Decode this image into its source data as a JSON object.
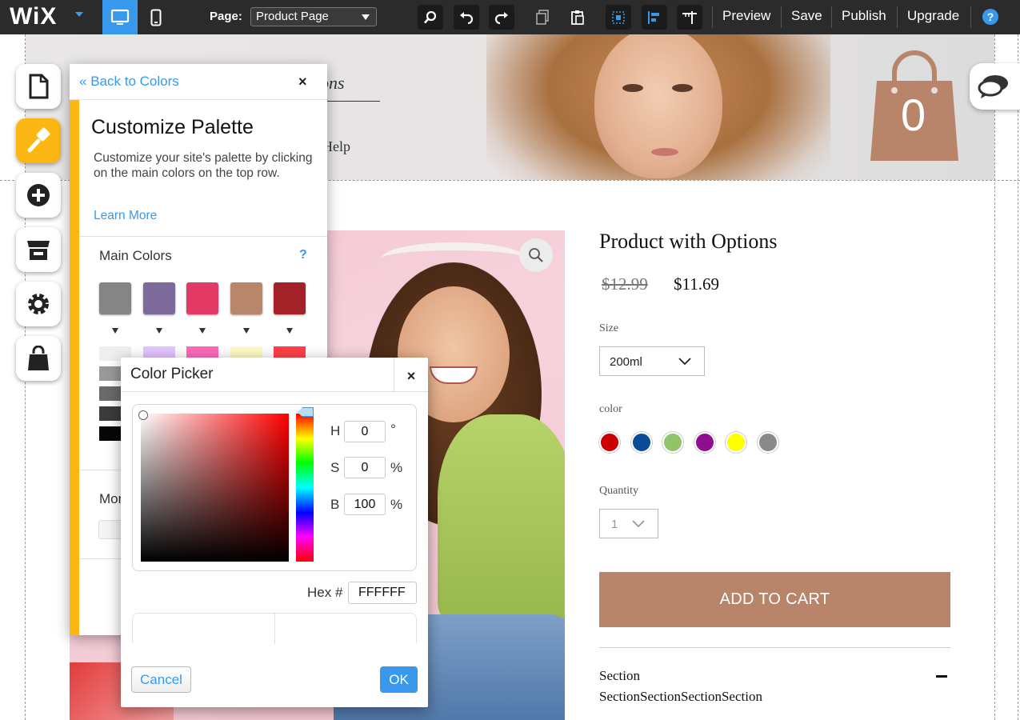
{
  "topbar": {
    "logo": "WiX",
    "page_label": "Page:",
    "page_value": "Product Page",
    "preview": "Preview",
    "save": "Save",
    "publish": "Publish",
    "upgrade": "Upgrade",
    "help": "?"
  },
  "header": {
    "nav_text": "ons",
    "help_text": "Help",
    "cart_count": "0"
  },
  "product": {
    "title": "Product with Options",
    "price_old": "$12.99",
    "price_new": "$11.69",
    "size_label": "Size",
    "size_value": "200ml",
    "color_label": "color",
    "colors": [
      "#cc0000",
      "#0b4c9a",
      "#8fc46b",
      "#8e0e8f",
      "#ffff00",
      "#8a8a8a"
    ],
    "quantity_label": "Quantity",
    "quantity_value": "1",
    "add_to_cart": "ADD TO CART",
    "section_title": "Section",
    "section_body": "SectionSectionSectionSection"
  },
  "palette_panel": {
    "back": "Back to Colors",
    "close": "×",
    "title": "Customize Palette",
    "description": "Customize your site's palette by clicking on the main colors on the top row.",
    "learn_more": "Learn More",
    "main_colors_label": "Main Colors",
    "help": "?",
    "main_colors": [
      "#858585",
      "#7b6a9a",
      "#e33965",
      "#b8876b",
      "#a32227"
    ],
    "more_label": "Mor"
  },
  "color_picker": {
    "title": "Color Picker",
    "close": "×",
    "h_label": "H",
    "h_value": "0",
    "h_unit": "°",
    "s_label": "S",
    "s_value": "0",
    "s_unit": "%",
    "b_label": "B",
    "b_value": "100",
    "b_unit": "%",
    "hex_label": "Hex #",
    "hex_value": "FFFFFF",
    "cancel": "Cancel",
    "ok": "OK"
  },
  "colors": {
    "accent_blue": "#3899ec",
    "accent_yellow": "#fcb712",
    "cart_brown": "#b8856a"
  }
}
